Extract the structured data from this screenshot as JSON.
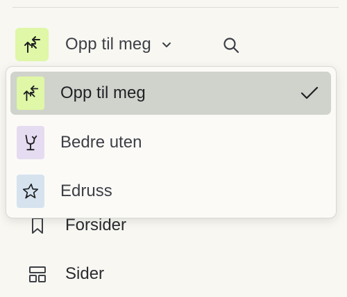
{
  "header": {
    "space_name": "Opp til meg",
    "space_icon_color": "#dff7a6"
  },
  "nav": {
    "items": [
      {
        "label": "Forsider",
        "icon": "bookmark-icon"
      },
      {
        "label": "Sider",
        "icon": "layout-icon"
      }
    ]
  },
  "dropdown": {
    "selected_index": 0,
    "items": [
      {
        "label": "Opp til meg",
        "icon": "arrows-converge-icon",
        "icon_color": "#dff7a6",
        "selected": true
      },
      {
        "label": "Bedre uten",
        "icon": "broken-glass-icon",
        "icon_color": "#e6dcf1",
        "selected": false
      },
      {
        "label": "Edruss",
        "icon": "star-icon",
        "icon_color": "#d6e3ef",
        "selected": false
      }
    ]
  },
  "colors": {
    "background": "#f8f7f2",
    "selected_row": "#cfd3cc",
    "text": "#2a2b30"
  }
}
